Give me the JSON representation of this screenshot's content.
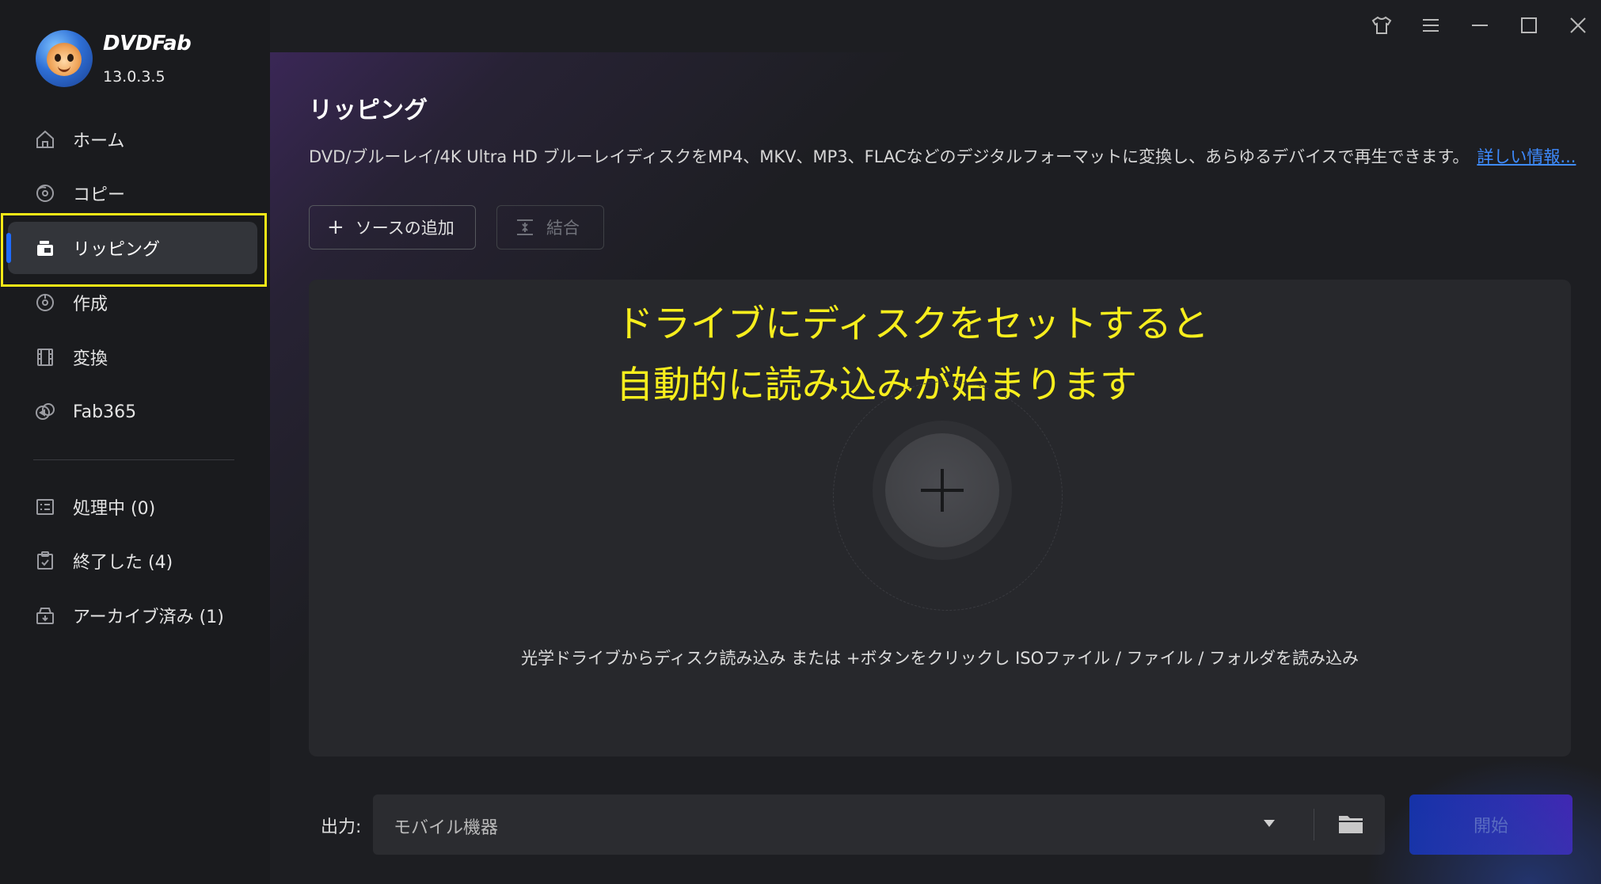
{
  "app": {
    "brand": "DVDFab",
    "version": "13.0.3.5"
  },
  "sidebar": {
    "items": [
      {
        "label": "ホーム",
        "icon": "home-icon"
      },
      {
        "label": "コピー",
        "icon": "copy-disc-icon"
      },
      {
        "label": "リッピング",
        "icon": "ripper-icon",
        "active": true
      },
      {
        "label": "作成",
        "icon": "creator-disc-icon"
      },
      {
        "label": "変換",
        "icon": "film-icon"
      },
      {
        "label": "Fab365",
        "icon": "fab365-icon"
      }
    ],
    "queues": [
      {
        "label": "処理中 (0)",
        "icon": "task-list-icon"
      },
      {
        "label": "終了した (4)",
        "icon": "clipboard-check-icon"
      },
      {
        "label": "アーカイブ済み (1)",
        "icon": "archive-box-icon"
      }
    ]
  },
  "window": {
    "controls": [
      "tshirt-icon",
      "menu-icon",
      "minimize-icon",
      "maximize-icon",
      "close-icon"
    ]
  },
  "main": {
    "title": "リッピング",
    "description": "DVD/ブルーレイ/4K Ultra HD ブルーレイディスクをMP4、MKV、MP3、FLACなどのデジタルフォーマットに変換し、あらゆるデバイスで再生できます。",
    "more_link": "詳しい情報...",
    "add_source": "ソースの追加",
    "merge": "結合",
    "overlay_line1": "ドライブにディスクをセットすると",
    "overlay_line2": "自動的に読み込みが始まります",
    "hint": "光学ドライブからディスク読み込み または +ボタンをクリックし ISOファイル / ファイル / フォルダを読み込み",
    "output_label": "出力:",
    "output_value": "モバイル機器",
    "start": "開始"
  },
  "colors": {
    "accent": "#1f6bff",
    "highlight": "#f5ea16",
    "annotation_text": "#f7ee1d"
  }
}
